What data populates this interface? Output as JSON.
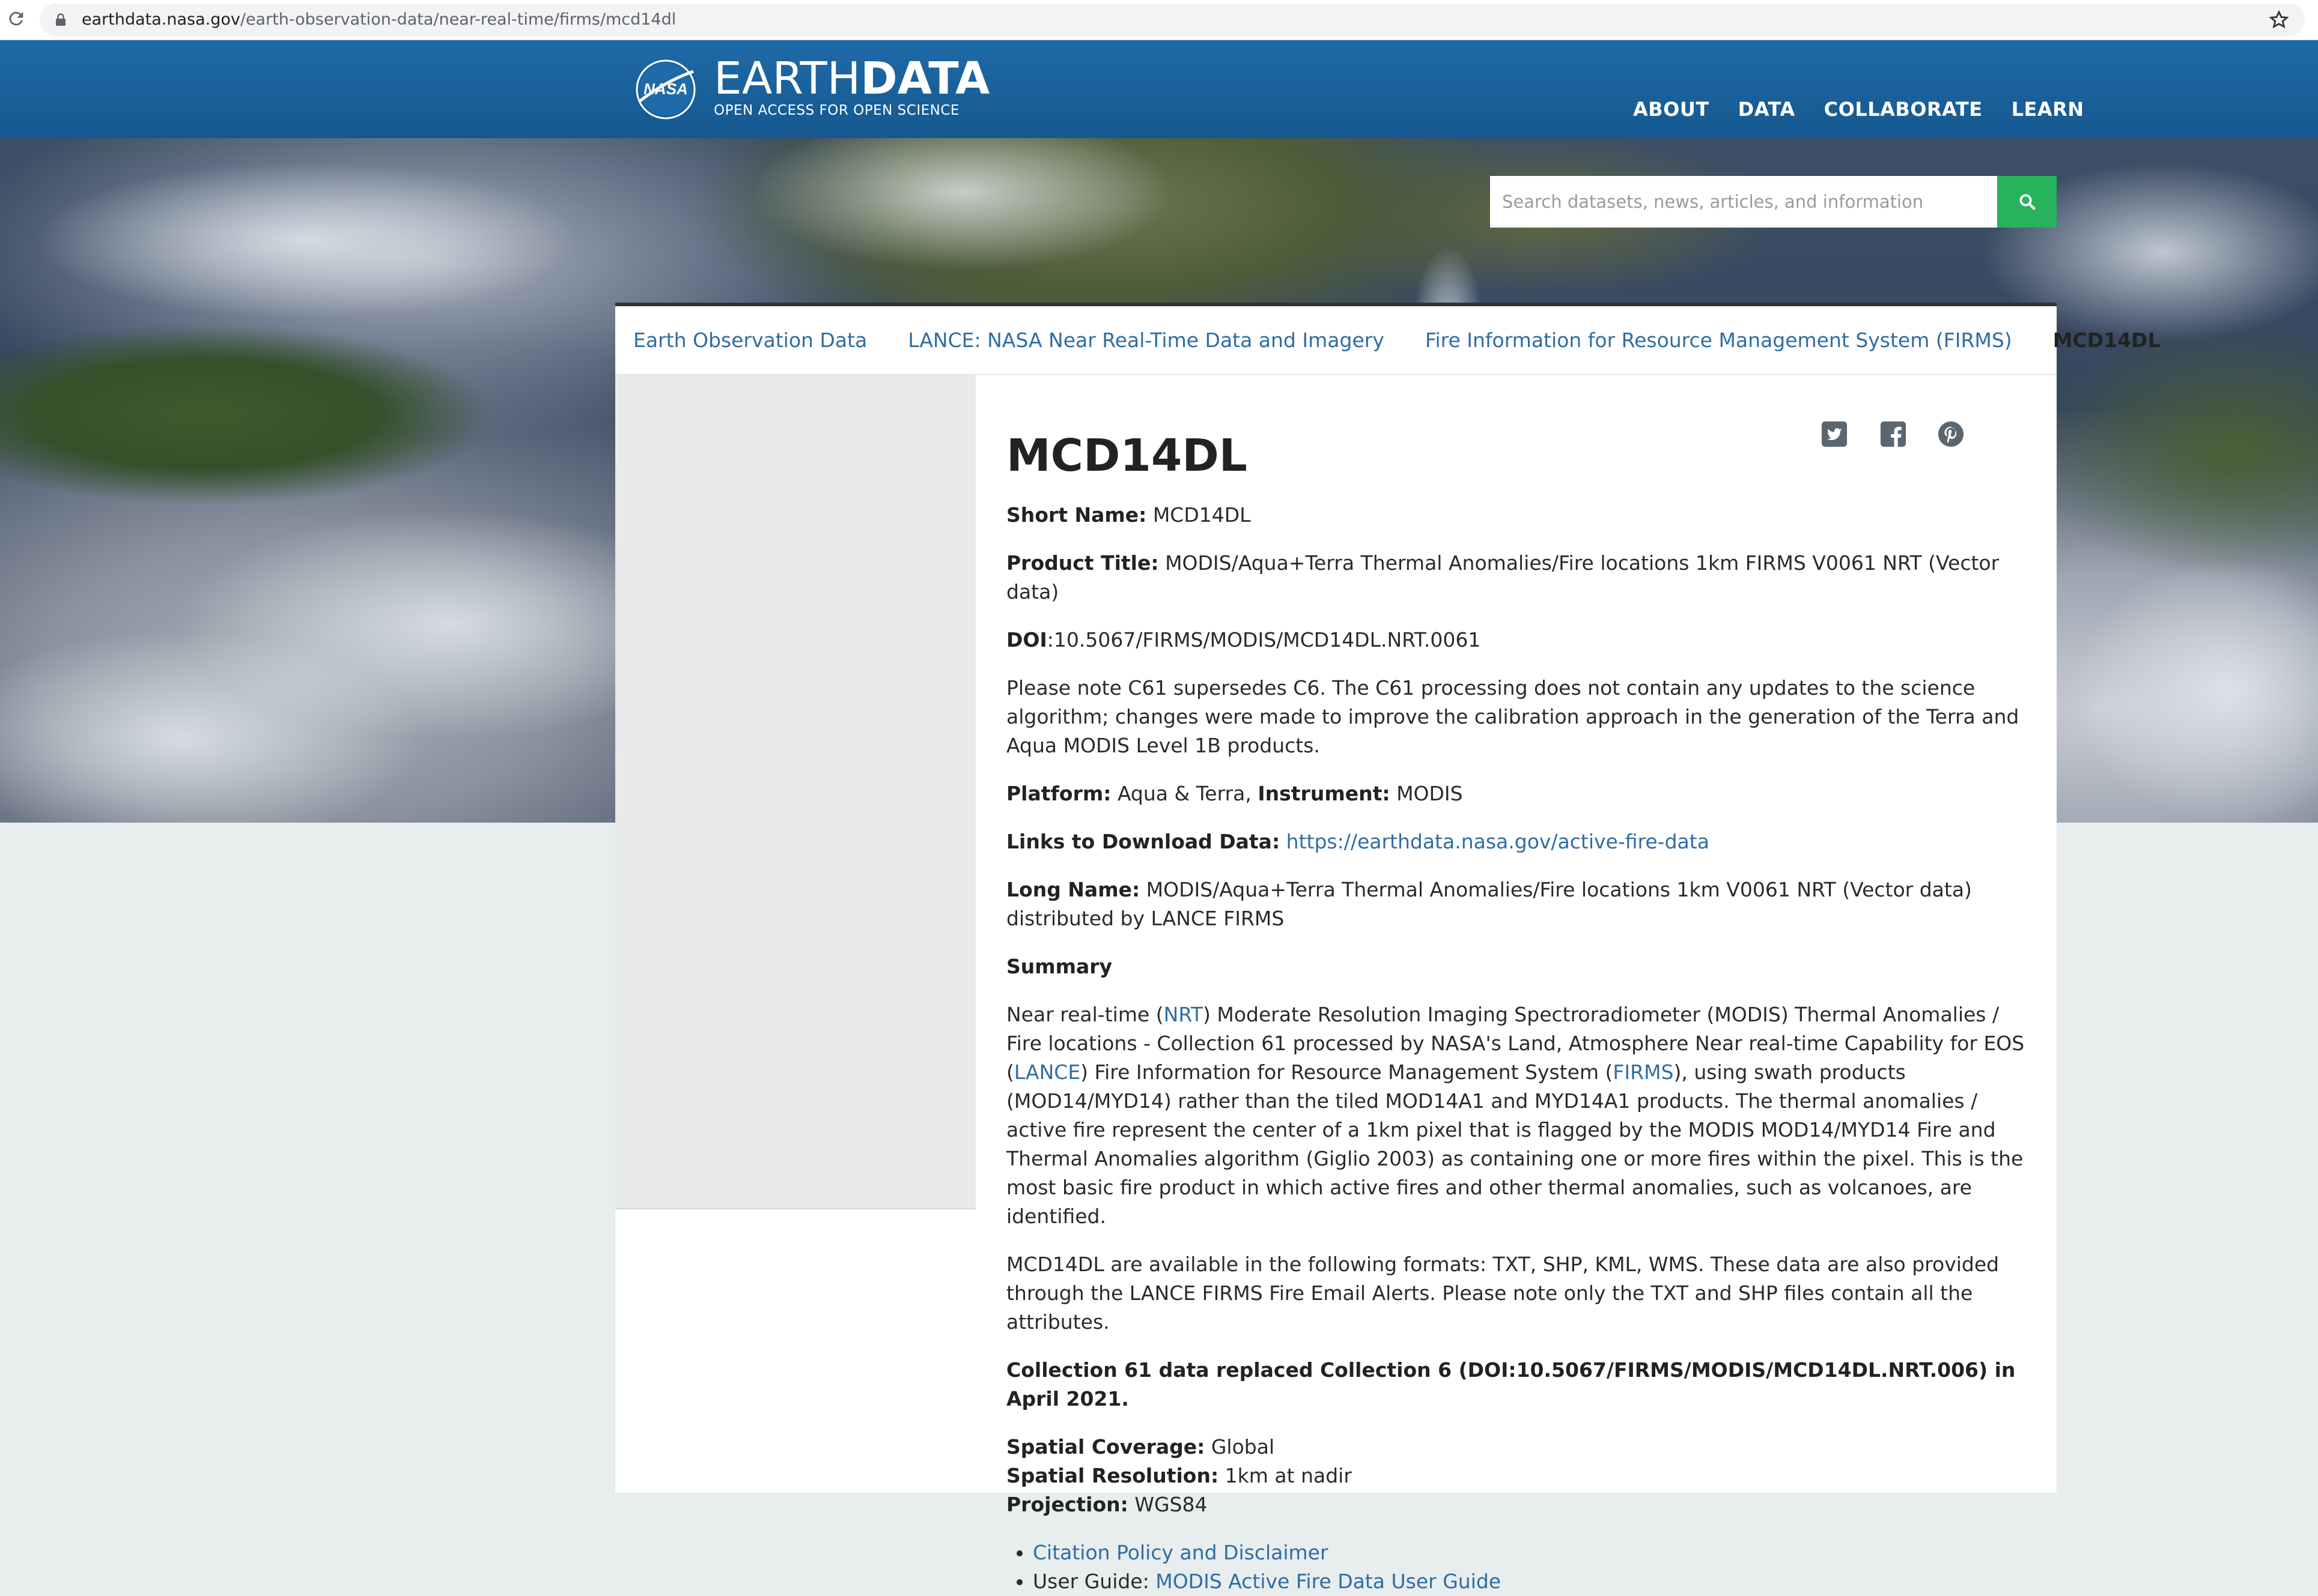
{
  "browser": {
    "url_domain": "earthdata.nasa.gov",
    "url_path": "/earth-observation-data/near-real-time/firms/mcd14dl"
  },
  "header": {
    "logo_text": "NASA",
    "brand_light": "EARTH",
    "brand_bold": "DATA",
    "tagline": "OPEN ACCESS FOR OPEN SCIENCE",
    "nav": [
      "ABOUT",
      "DATA",
      "COLLABORATE",
      "LEARN"
    ]
  },
  "search": {
    "placeholder": "Search datasets, news, articles, and information"
  },
  "breadcrumb": {
    "items": [
      "Earth Observation Data",
      "LANCE: NASA Near Real-Time Data and Imagery",
      "Fire Information for Resource Management System (FIRMS)"
    ],
    "current": "MCD14DL"
  },
  "share": [
    "twitter-icon",
    "facebook-icon",
    "pinterest-icon"
  ],
  "colors": {
    "header_blue": "#1f6aa8",
    "search_green": "#27b35c",
    "link_blue": "#2e6da4"
  },
  "content": {
    "title": "MCD14DL",
    "short_name_label": "Short Name:",
    "short_name": "MCD14DL",
    "product_title_label": "Product Title:",
    "product_title": "MODIS/Aqua+Terra Thermal Anomalies/Fire locations 1km FIRMS V0061 NRT (Vector data)",
    "doi_label": "DOI",
    "doi": ":10.5067/FIRMS/MODIS/MCD14DL.NRT.0061",
    "note": "Please note C61 supersedes C6. The C61 processing does not contain any updates to the science algorithm; changes were made to improve the calibration approach in the generation of the Terra and Aqua MODIS Level 1B products.",
    "platform_label": "Platform:",
    "platform": "Aqua & Terra,",
    "instrument_label": "Instrument:",
    "instrument": "MODIS",
    "download_label": "Links to Download Data:",
    "download_link": "https://earthdata.nasa.gov/active-fire-data",
    "long_name_label": "Long Name:",
    "long_name": "MODIS/Aqua+Terra Thermal Anomalies/Fire locations 1km V0061 NRT (Vector data) distributed by LANCE FIRMS",
    "summary_heading": "Summary",
    "summary_1": "Near real-time (",
    "summary_nrt": "NRT",
    "summary_2": ") Moderate Resolution Imaging Spectroradiometer (MODIS) Thermal Anomalies / Fire locations - Collection 61 processed by NASA's Land, Atmosphere Near real-time Capability for EOS (",
    "summary_lance": "LANCE",
    "summary_3": ") Fire Information for Resource Management System (",
    "summary_firms": "FIRMS",
    "summary_4": "), using swath products (MOD14/MYD14) rather than the tiled MOD14A1 and MYD14A1 products. The thermal anomalies / active fire represent the center of a 1km pixel that is flagged by the MODIS MOD14/MYD14 Fire and Thermal Anomalies algorithm (Giglio 2003) as containing one or more fires within the pixel. This is the most basic fire product in which active fires and other thermal anomalies, such as volcanoes, are identified.",
    "formats": "MCD14DL are available in the following formats: TXT, SHP, KML, WMS. These data are also provided through the LANCE FIRMS Fire Email Alerts. Please note only the TXT and SHP files contain all the attributes.",
    "collection_note": "Collection 61 data replaced Collection 6 (DOI:10.5067/FIRMS/MODIS/MCD14DL.NRT.006) in April 2021.",
    "coverage_label": "Spatial Coverage:",
    "coverage": "Global",
    "resolution_label": "Spatial Resolution:",
    "resolution": "1km at nadir",
    "projection_label": "Projection:",
    "projection": "WGS84",
    "citation_link": "Citation Policy and Disclaimer",
    "user_guide_label": "User Guide:",
    "user_guide_link": "MODIS Active Fire Data User Guide"
  }
}
